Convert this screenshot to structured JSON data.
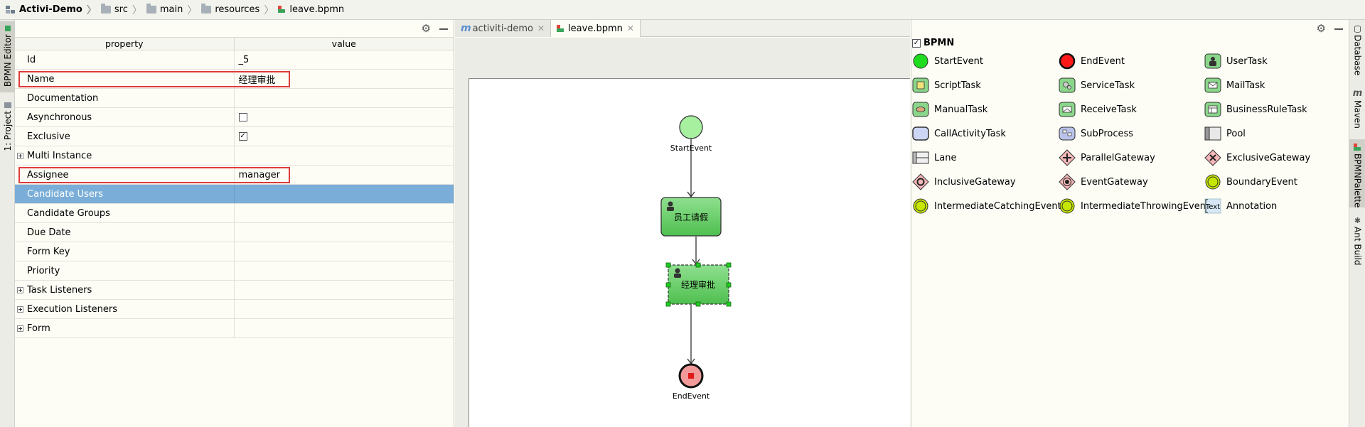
{
  "breadcrumb": [
    "Activi-Demo",
    "src",
    "main",
    "resources",
    "leave.bpmn"
  ],
  "left_strip": {
    "tab_bpmn_editor": "BPMN Editor",
    "tab_project": "1: Project"
  },
  "right_strip": {
    "database": "Database",
    "maven": "Maven",
    "bpmn_palette": "BPMNPalette",
    "ant_build": "Ant Build"
  },
  "properties": {
    "header_property": "property",
    "header_value": "value",
    "rows": [
      {
        "label": "Id",
        "value": "_5"
      },
      {
        "label": "Name",
        "value": "经理审批"
      },
      {
        "label": "Documentation",
        "value": ""
      },
      {
        "label": "Asynchronous",
        "value": ""
      },
      {
        "label": "Exclusive",
        "value": "✓"
      },
      {
        "label": "Multi Instance",
        "value": ""
      },
      {
        "label": "Assignee",
        "value": "manager"
      },
      {
        "label": "Candidate Users",
        "value": ""
      },
      {
        "label": "Candidate Groups",
        "value": ""
      },
      {
        "label": "Due Date",
        "value": ""
      },
      {
        "label": "Form Key",
        "value": ""
      },
      {
        "label": "Priority",
        "value": ""
      },
      {
        "label": "Task Listeners",
        "value": ""
      },
      {
        "label": "Execution Listeners",
        "value": ""
      },
      {
        "label": "Form",
        "value": ""
      }
    ]
  },
  "editor": {
    "tabs": [
      {
        "label": "activiti-demo"
      },
      {
        "label": "leave.bpmn"
      }
    ],
    "diagram": {
      "start_label": "StartEvent",
      "task1_label": "员工请假",
      "task2_label": "经理审批",
      "end_label": "EndEvent"
    }
  },
  "palette": {
    "title": "BPMN",
    "items": [
      "StartEvent",
      "EndEvent",
      "UserTask",
      "ScriptTask",
      "ServiceTask",
      "MailTask",
      "ManualTask",
      "ReceiveTask",
      "BusinessRuleTask",
      "CallActivityTask",
      "SubProcess",
      "Pool",
      "Lane",
      "ParallelGateway",
      "ExclusiveGateway",
      "InclusiveGateway",
      "EventGateway",
      "BoundaryEvent",
      "IntermediateCatchingEvent",
      "IntermediateThrowingEvent",
      "Annotation"
    ],
    "annotation_icon_text": "Text"
  }
}
